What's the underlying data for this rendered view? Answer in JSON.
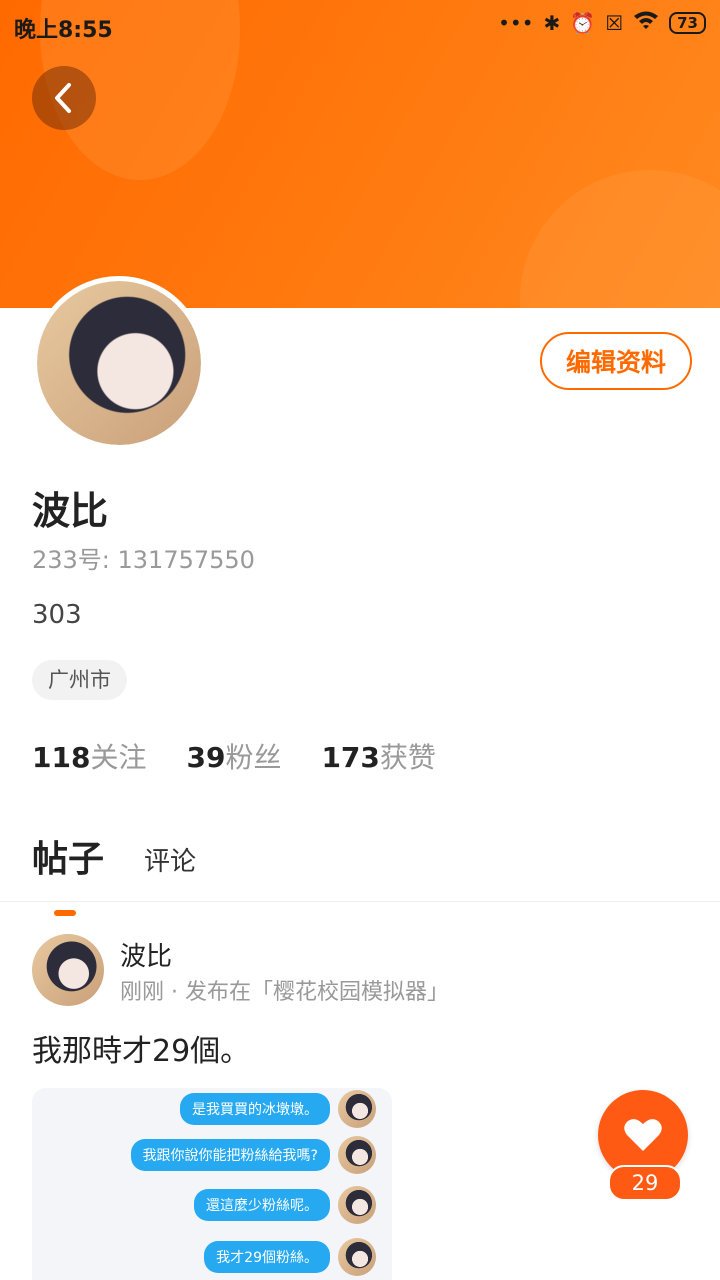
{
  "status_bar": {
    "time": "晚上8:55",
    "battery": "73"
  },
  "profile": {
    "edit_label": "编辑资料",
    "name": "波比",
    "uid": "233号: 131757550",
    "bio": "303",
    "location": "广州市",
    "stats": [
      {
        "count": "118",
        "label": "关注"
      },
      {
        "count": "39",
        "label": "粉丝"
      },
      {
        "count": "173",
        "label": "获赞"
      }
    ]
  },
  "tabs": [
    {
      "label": "帖子",
      "active": true
    },
    {
      "label": "评论",
      "active": false
    }
  ],
  "post": {
    "author": "波比",
    "meta": "刚刚 · 发布在「樱花校园模拟器」",
    "text": "我那時才29個。",
    "image_messages": [
      "是我買買的冰墩墩。",
      "我跟你說你能把粉絲給我嗎?",
      "還這麼少粉絲呢。",
      "我才29個粉絲。"
    ],
    "like_count": "29"
  },
  "colors": {
    "accent": "#ff6a00",
    "like": "#ff5a14",
    "bubble": "#26a9f1"
  }
}
